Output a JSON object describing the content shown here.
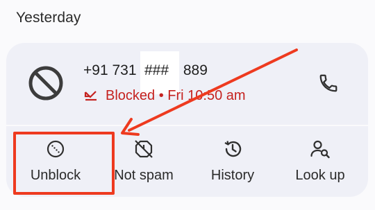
{
  "section": {
    "label": "Yesterday"
  },
  "call": {
    "number_prefix": "+91 731 ",
    "number_masked": "###",
    "number_suffix": " 889",
    "status_text": "Blocked • Fri 10:50 am",
    "status_color": "#c5221f"
  },
  "avatar": {
    "icon": "blocked-icon"
  },
  "call_button": {
    "icon": "phone-icon"
  },
  "actions": [
    {
      "label": "Unblock",
      "icon": "unblock-icon"
    },
    {
      "label": "Not spam",
      "icon": "not-spam-icon"
    },
    {
      "label": "History",
      "icon": "history-icon"
    },
    {
      "label": "Look up",
      "icon": "look-up-icon"
    }
  ],
  "annotation": {
    "color": "#ee3a1f",
    "target": "Unblock"
  },
  "colors": {
    "card": "#eff0f7",
    "background": "#fafafc",
    "accent_red": "#c5221f",
    "annotation_red": "#ee3a1f"
  }
}
